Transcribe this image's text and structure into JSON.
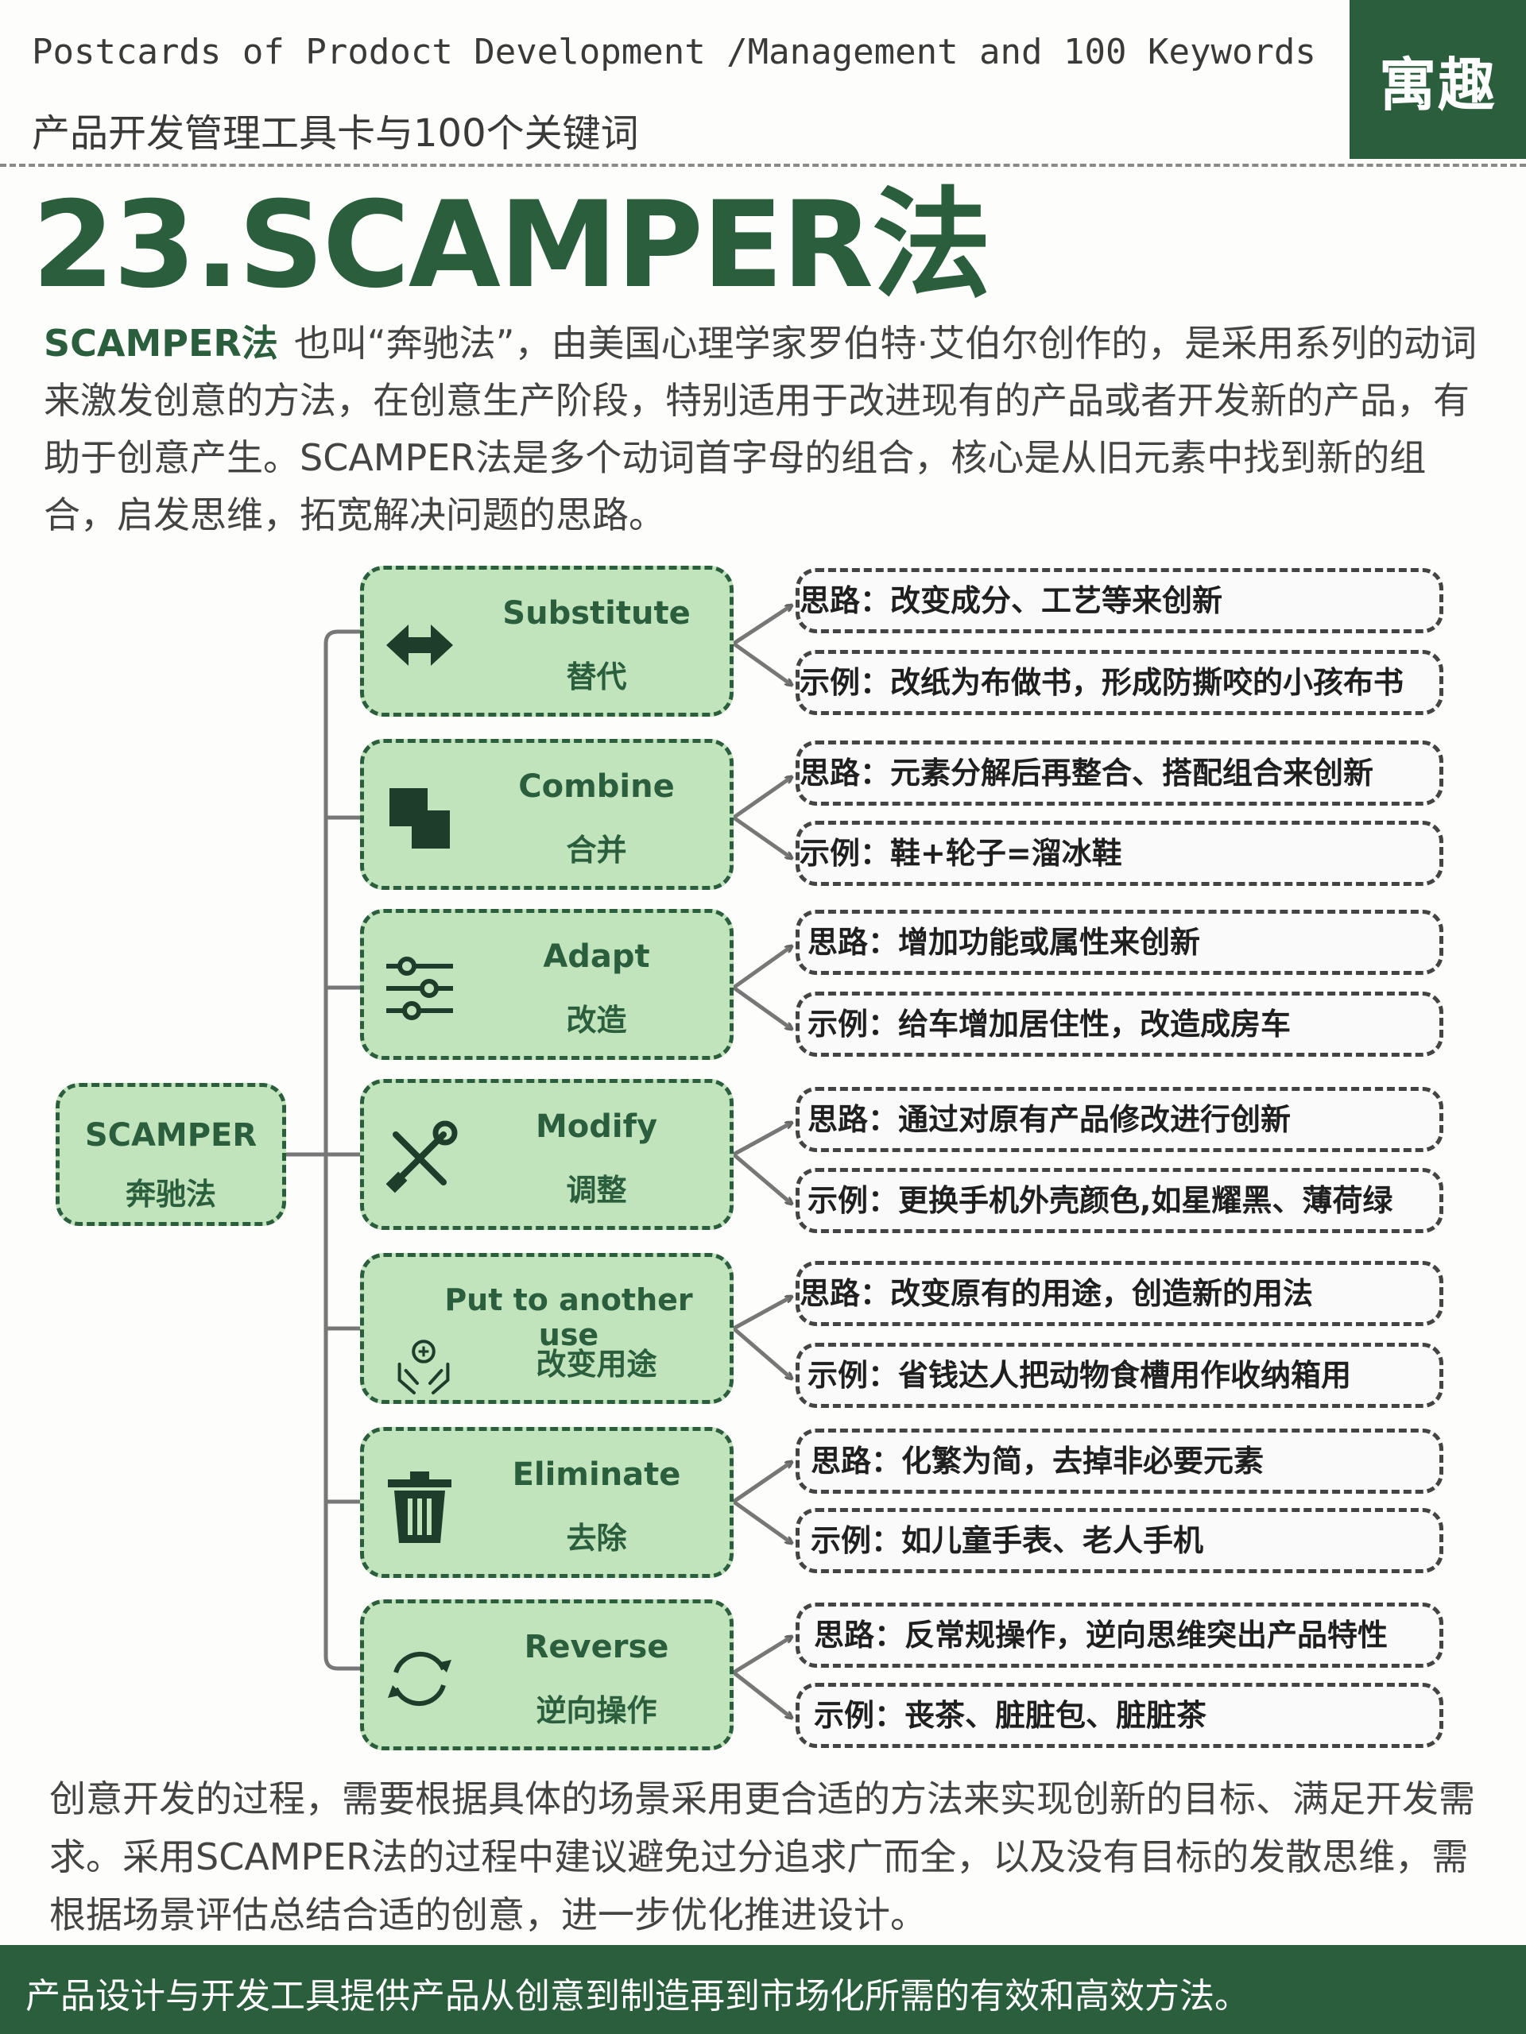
{
  "header": {
    "en_title": "Postcards of Prodoct Development /Management and 100 Keywords",
    "cn_title": "产品开发管理工具卡与100个关键词",
    "brand": "寓趣"
  },
  "title": "23.SCAMPER法",
  "intro": {
    "bold": "SCAMPER法",
    "text": "也叫“奔驰法”，由美国心理学家罗伯特·艾伯尔创作的，是采用系列的动词来激发创意的方法，在创意生产阶段，特别适用于改进现有的产品或者开发新的产品，有助于创意产生。SCAMPER法是多个动词首字母的组合，核心是从旧元素中找到新的组合，启发思维，拓宽解决问题的思路。"
  },
  "diagram": {
    "root": {
      "en": "SCAMPER",
      "cn": "奔驰法"
    },
    "items": [
      {
        "en": "Substitute",
        "cn": "替代",
        "icon": "swap-arrows-icon",
        "idea": "思路：改变成分、工艺等来创新",
        "example": "示例：改纸为布做书，形成防撕咬的小孩布书"
      },
      {
        "en": "Combine",
        "cn": "合并",
        "icon": "overlapping-squares-icon",
        "idea": "思路：元素分解后再整合、搭配组合来创新",
        "example": "示例：鞋+轮子=溜冰鞋"
      },
      {
        "en": "Adapt",
        "cn": "改造",
        "icon": "sliders-icon",
        "idea": "思路：增加功能或属性来创新",
        "example": "示例：给车增加居住性，改造成房车"
      },
      {
        "en": "Modify",
        "cn": "调整",
        "icon": "tools-icon",
        "idea": "思路：通过对原有产品修改进行创新",
        "example": "示例：更换手机外壳颜色,如星耀黑、薄荷绿"
      },
      {
        "en": "Put to another use",
        "cn": "改变用途",
        "icon": "hands-icon",
        "idea": "思路：改变原有的用途，创造新的用法",
        "example": "示例：省钱达人把动物食槽用作收纳箱用"
      },
      {
        "en": "Eliminate",
        "cn": "去除",
        "icon": "trash-icon",
        "idea": "思路：化繁为简，去掉非必要元素",
        "example": "示例：如儿童手表、老人手机"
      },
      {
        "en": "Reverse",
        "cn": "逆向操作",
        "icon": "cycle-arrows-icon",
        "idea": "思路：反常规操作，逆向思维突出产品特性",
        "example": "示例：丧茶、脏脏包、脏脏茶"
      }
    ]
  },
  "outro": "创意开发的过程，需要根据具体的场景采用更合适的方法来实现创新的目标、满足开发需求。采用SCAMPER法的过程中建议避免过分追求广而全，以及没有目标的发散思维，需根据场景评估总结合适的创意，进一步优化推进设计。",
  "footer": "产品设计与开发工具提供产品从创意到制造再到市场化所需的有效和高效方法。",
  "colors": {
    "primary": "#2b5e3d",
    "box_fill": "#c2e4bd"
  }
}
